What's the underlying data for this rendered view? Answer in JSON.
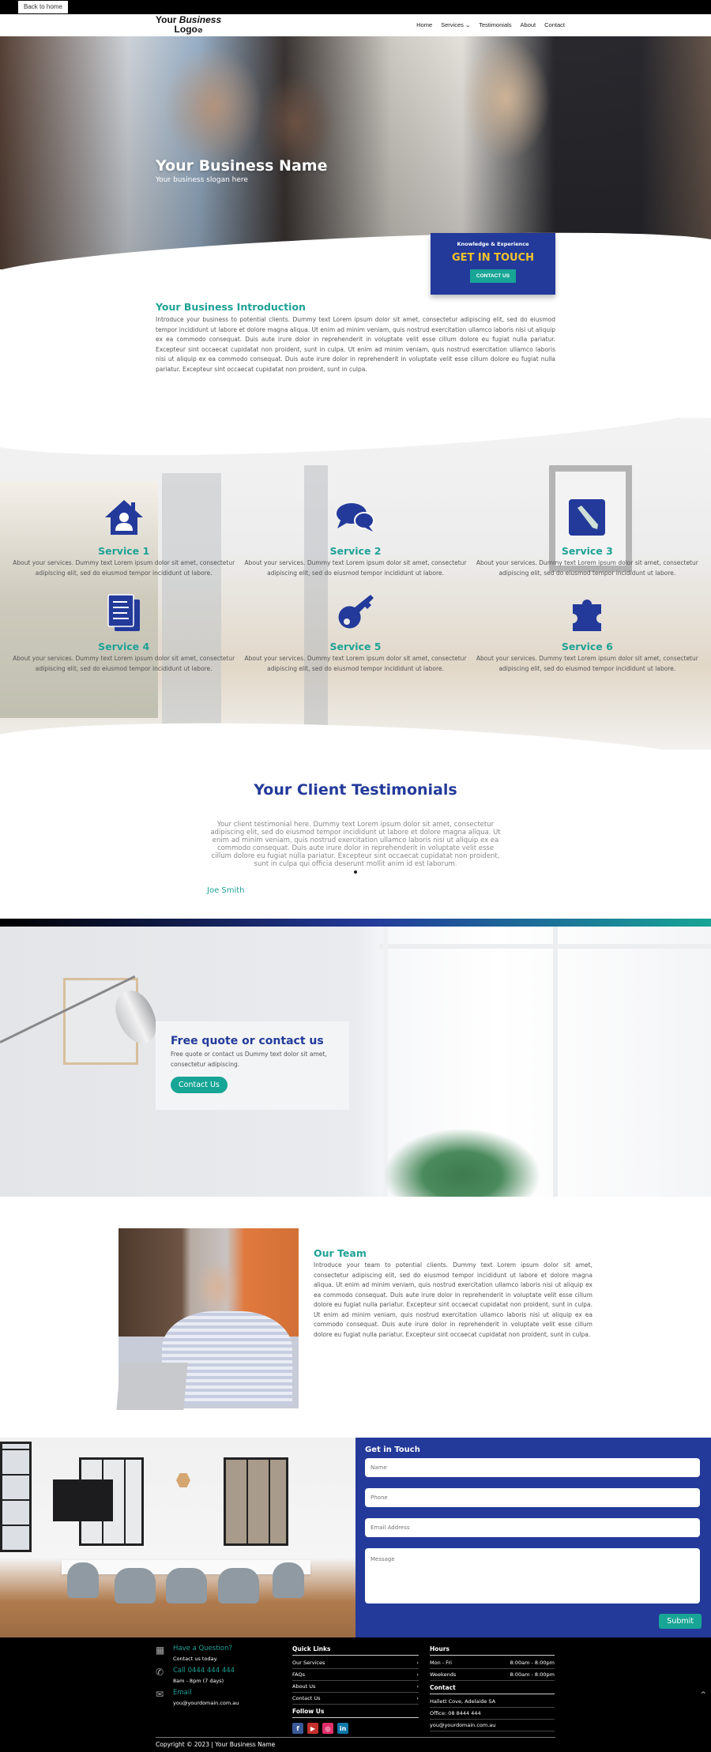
{
  "topbar": {
    "back_label": "Back to home"
  },
  "header": {
    "logo_line1_plain": "Your ",
    "logo_line1_italic": "Business",
    "logo_line2": "Logo",
    "nav": [
      {
        "label": "Home"
      },
      {
        "label": "Services ⌄"
      },
      {
        "label": "Testimonials"
      },
      {
        "label": "About"
      },
      {
        "label": "Contact"
      }
    ]
  },
  "hero": {
    "title": "Your Business Name",
    "slogan": "Your business slogan here",
    "cta_kicker": "Knowledge & Experience",
    "cta_heading": "GET IN TOUCH",
    "cta_button": "CONTACT US"
  },
  "intro": {
    "heading": "Your Business Introduction",
    "body": "Introduce your business to potential clients. Dummy text Lorem ipsum dolor sit amet, consectetur adipiscing elit, sed do eiusmod tempor incididunt ut labore et dolore magna aliqua. Ut enim ad minim veniam, quis nostrud exercitation ullamco laboris nisi ut aliquip ex ea commodo consequat. Duis aute irure dolor in reprehenderit in voluptate velit esse cillum dolore eu fugiat nulla pariatur. Excepteur sint occaecat cupidatat non proident, sunt in culpa. Ut enim ad minim veniam, quis nostrud exercitation ullamco laboris nisi ut aliquip ex ea commodo consequat. Duis aute irure dolor in reprehenderit in voluptate velit esse cillum dolore eu fugiat nulla pariatur. Excepteur sint occaecat cupidatat non proident, sunt in culpa."
  },
  "services": {
    "accent": "#233a9a",
    "items": [
      {
        "icon": "house-user-icon",
        "title": "Service 1",
        "text": "About your services. Dummy text Lorem ipsum dolor sit amet, consectetur adipiscing elit, sed do eiusmod tempor incididunt ut labore."
      },
      {
        "icon": "chat-bubbles-icon",
        "title": "Service 2",
        "text": "About your services. Dummy text Lorem ipsum dolor sit amet, consectetur adipiscing elit, sed do eiusmod tempor incididunt ut labore."
      },
      {
        "icon": "pencil-square-icon",
        "title": "Service 3",
        "text": "About your services. Dummy text Lorem ipsum dolor sit amet, consectetur adipiscing elit, sed do eiusmod tempor incididunt ut labore."
      },
      {
        "icon": "documents-icon",
        "title": "Service 4",
        "text": "About your services. Dummy text Lorem ipsum dolor sit amet, consectetur adipiscing elit, sed do eiusmod tempor incididunt ut labore."
      },
      {
        "icon": "key-icon",
        "title": "Service 5",
        "text": "About your services. Dummy text Lorem ipsum dolor sit amet, consectetur adipiscing elit, sed do eiusmod tempor incididunt ut labore."
      },
      {
        "icon": "puzzle-icon",
        "title": "Service 6",
        "text": "About your services. Dummy text Lorem ipsum dolor sit amet, consectetur adipiscing elit, sed do eiusmod tempor incididunt ut labore."
      }
    ]
  },
  "testimonials": {
    "heading": "Your Client Testimonials",
    "quote": "Your client testimonial here. Dummy text Lorem ipsum dolor sit amet, consectetur adipiscing elit, sed do eiusmod tempor incididunt ut labore et dolore magna aliqua. Ut enim ad minim veniam, quis nostrud exercitation ullamco laboris nisi ut aliquip ex ea commodo consequat. Duis aute irure dolor in reprehenderit in voluptate velit esse cillum dolore eu fugiat nulla pariatur. Excepteur sint occaecat cupidatat non proident, sunt in culpa qui officia deserunt mollit anim id est laborum.",
    "author": "Joe Smith"
  },
  "quote_section": {
    "heading": "Free quote or contact us",
    "body": "Free quote or contact us Dummy text dolor sit amet, consectetur adipiscing.",
    "button": "Contact Us"
  },
  "team": {
    "heading": "Our Team",
    "body": "Introduce your team to potential clients. Dummy text Lorem ipsum dolor sit amet, consectetur adipiscing elit, sed do eiusmod tempor incididunt ut labore et dolore magna aliqua. Ut enim ad minim veniam, quis nostrud exercitation ullamco laboris nisi ut aliquip ex ea commodo consequat. Duis aute irure dolor in reprehenderit in voluptate velit esse cillum dolore eu fugiat nulla pariatur. Excepteur sint occaecat cupidatat non proident, sunt in culpa. Ut enim ad minim veniam, quis nostrud exercitation ullamco laboris nisi ut aliquip ex ea commodo consequat. Duis aute irure dolor in reprehenderit in voluptate velit esse cillum dolore eu fugiat nulla pariatur. Excepteur sint occaecat cupidatat non proident, sunt in culpa."
  },
  "contact_form": {
    "heading": "Get in Touch",
    "name_placeholder": "Name",
    "phone_placeholder": "Phone",
    "email_placeholder": "Email Address",
    "message_placeholder": "Message",
    "submit": "Submit"
  },
  "footer": {
    "question_title": "Have a Question?",
    "question_sub": "Contact us today.",
    "call_title": "Call 0444 444 444",
    "call_sub": "8am - 8pm (7 days)",
    "email_title": "Email",
    "email_sub": "you@yourdomain.com.au",
    "quick_links_heading": "Quick Links",
    "quick_links": [
      {
        "label": "Our Services"
      },
      {
        "label": "FAQs"
      },
      {
        "label": "About Us"
      },
      {
        "label": "Contact Us"
      }
    ],
    "follow_heading": "Follow Us",
    "socials": [
      {
        "name": "facebook",
        "glyph": "f",
        "color": "#3b5998"
      },
      {
        "name": "youtube",
        "glyph": "▶",
        "color": "#c4302b"
      },
      {
        "name": "instagram",
        "glyph": "◎",
        "color": "#e1306c"
      },
      {
        "name": "linkedin",
        "glyph": "in",
        "color": "#0e76a8"
      }
    ],
    "hours_heading": "Hours",
    "hours": [
      {
        "day": "Mon - Fri",
        "time": "8:00am - 8:00pm"
      },
      {
        "day": "Weekends",
        "time": "8:00am - 8:00pm"
      }
    ],
    "contact_heading": "Contact",
    "contact_lines": [
      {
        "text": "Hallett Cove, Adelaide SA"
      },
      {
        "text": "Office: 08 8444 444"
      },
      {
        "text": "you@yourdomain.com.au"
      }
    ],
    "copyright": "Copyright © 2023 | Your Business Name",
    "back_to_top": "^"
  }
}
